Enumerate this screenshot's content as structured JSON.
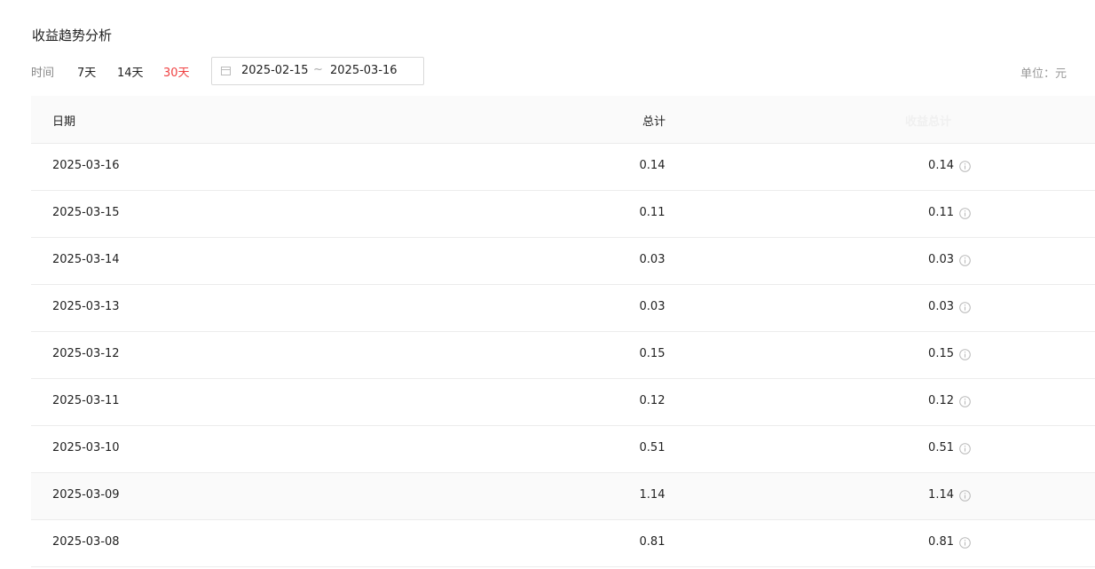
{
  "page": {
    "title": "收益趋势分析"
  },
  "filter": {
    "time_label": "时间",
    "ranges": [
      "7天",
      "14天",
      "30天"
    ],
    "active_range": "30天",
    "date_start": "2025-02-15",
    "date_separator": "~",
    "date_end": "2025-03-16",
    "unit_label": "单位：元"
  },
  "table": {
    "columns": [
      "日期",
      "总计",
      "收益总计"
    ],
    "rows": [
      {
        "date": "2025-03-16",
        "total": "0.14",
        "sub": "0.14"
      },
      {
        "date": "2025-03-15",
        "total": "0.11",
        "sub": "0.11"
      },
      {
        "date": "2025-03-14",
        "total": "0.03",
        "sub": "0.03"
      },
      {
        "date": "2025-03-13",
        "total": "0.03",
        "sub": "0.03"
      },
      {
        "date": "2025-03-12",
        "total": "0.15",
        "sub": "0.15"
      },
      {
        "date": "2025-03-11",
        "total": "0.12",
        "sub": "0.12"
      },
      {
        "date": "2025-03-10",
        "total": "0.51",
        "sub": "0.51"
      },
      {
        "date": "2025-03-09",
        "total": "1.14",
        "sub": "1.14"
      },
      {
        "date": "2025-03-08",
        "total": "0.81",
        "sub": "0.81"
      }
    ],
    "hovered_row_index": 7
  },
  "colors": {
    "accent": "#f04142",
    "muted": "#888888",
    "border": "#ececec",
    "header_bg": "#fafafa"
  },
  "icons": {
    "date_picker": "calendar-icon",
    "row_info": "info-circle-icon"
  }
}
